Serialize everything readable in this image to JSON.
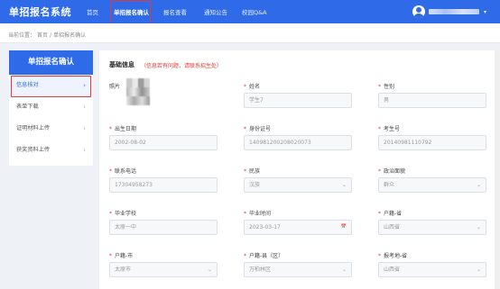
{
  "header": {
    "brand": "单招报名系统",
    "nav": [
      "首页",
      "单招报名确认",
      "报名查看",
      "通知公告",
      "校园Q&A"
    ],
    "active_nav": "单招报名确认"
  },
  "breadcrumb": {
    "prefix": "当前位置：",
    "home": "首页",
    "separator": "/",
    "current": "单招报名确认"
  },
  "sidebar": {
    "title": "单招报名确认",
    "items": [
      "信息核对",
      "表单下载",
      "证明材料上传",
      "获奖资料上传"
    ],
    "active_index": 0
  },
  "main": {
    "section_title": "基础信息",
    "section_tip": "（信息若有问题，请联系招生处）",
    "fields": {
      "photo": {
        "label": "照片"
      },
      "name": {
        "label": "姓名",
        "value": "学生7"
      },
      "gender": {
        "label": "性别",
        "value": "男"
      },
      "birth": {
        "label": "出生日期",
        "value": "2002-08-02"
      },
      "id_no": {
        "label": "身份证号",
        "value": "140981200208020073"
      },
      "exam_no": {
        "label": "考生号",
        "value": "20140981110792"
      },
      "phone": {
        "label": "联系电话",
        "value": "17304958273"
      },
      "ethnic": {
        "label": "民族",
        "value": "汉族"
      },
      "political": {
        "label": "政治面貌",
        "value": "群众"
      },
      "school": {
        "label": "毕业学校",
        "value": "太原一中"
      },
      "grad_time": {
        "label": "毕业时间",
        "value": "2023-03-17"
      },
      "hukou_province": {
        "label": "户籍-省",
        "value": "山西省"
      },
      "hukou_city": {
        "label": "户籍-市",
        "value": "太原市"
      },
      "hukou_district": {
        "label": "户籍-县（区）",
        "value": "万柏林区"
      },
      "exam_province": {
        "label": "报考地-省",
        "value": "山西省"
      }
    }
  },
  "icons": {
    "chevron_right": "›",
    "chevron_down": "⌄",
    "calendar": "📅",
    "caret_down": "▾"
  },
  "colors": {
    "primary": "#2f6be8",
    "required": "#e53935",
    "highlight_box": "#e53935"
  }
}
